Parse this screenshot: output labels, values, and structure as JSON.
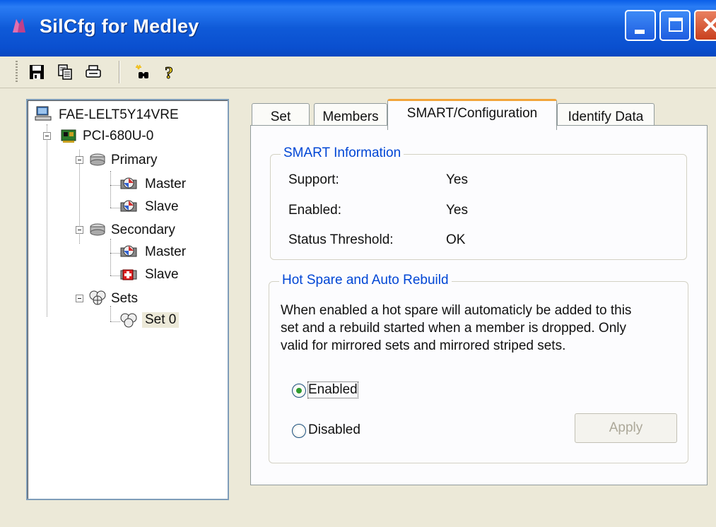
{
  "window": {
    "title": "SilCfg for Medley"
  },
  "toolbar": {
    "buttons": [
      {
        "icon": "save-icon"
      },
      {
        "icon": "copy-icon"
      },
      {
        "icon": "print-icon"
      },
      {
        "icon": "find-icon"
      },
      {
        "icon": "help-icon"
      }
    ]
  },
  "tree": {
    "root": "FAE-LELT5Y14VRE",
    "controller": "PCI-680U-0",
    "primary": "Primary",
    "primary_master": "Master",
    "primary_slave": "Slave",
    "secondary": "Secondary",
    "secondary_master": "Master",
    "secondary_slave": "Slave",
    "sets": "Sets",
    "set0": "Set 0"
  },
  "tabs": [
    "Set",
    "Members",
    "SMART/Configuration",
    "Identify Data"
  ],
  "smart": {
    "title": "SMART Information",
    "support_label": "Support:",
    "support_value": "Yes",
    "enabled_label": "Enabled:",
    "enabled_value": "Yes",
    "threshold_label": "Status Threshold:",
    "threshold_value": "OK"
  },
  "hotspare": {
    "title": "Hot Spare and Auto Rebuild",
    "desc_lines": [
      "When enabled a hot spare will automaticly be added to this",
      "set and a rebuild started when a member is dropped. Only",
      "valid for mirrored sets and mirrored striped sets."
    ],
    "enabled_label": "Enabled",
    "disabled_label": "Disabled",
    "selected": "Enabled",
    "apply_label": "Apply"
  },
  "colors": {
    "titlebar": "#0a54e0",
    "group_title": "#0046d5",
    "active_tab_accent": "#f2a53b"
  }
}
